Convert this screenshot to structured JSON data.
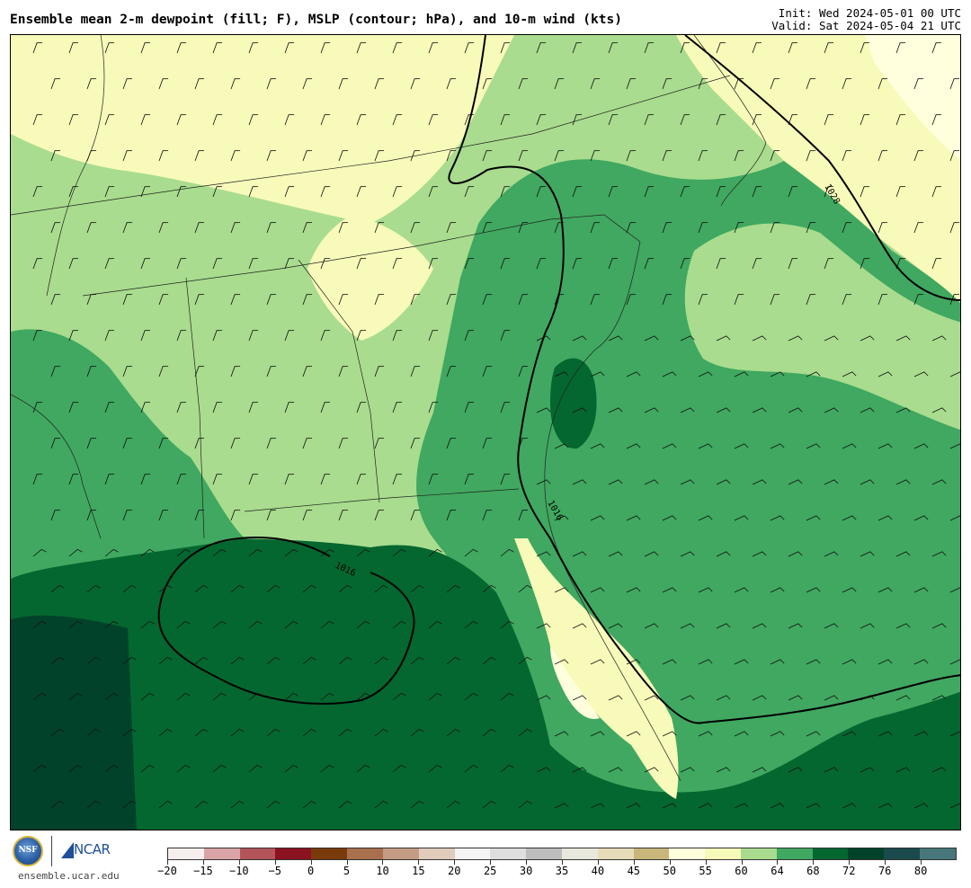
{
  "header": {
    "title": "Ensemble mean 2-m dewpoint (fill; F), MSLP (contour; hPa), and 10-m wind (kts)",
    "init": "Init: Wed 2024-05-01 00 UTC",
    "valid": "Valid: Sat 2024-05-04 21 UTC"
  },
  "map": {
    "contour_labels": [
      "1028",
      "1016",
      "1016"
    ]
  },
  "colorbar": {
    "ticks": [
      "−20",
      "−15",
      "−10",
      "−5",
      "0",
      "5",
      "10",
      "15",
      "20",
      "25",
      "30",
      "35",
      "40",
      "45",
      "50",
      "55",
      "60",
      "64",
      "68",
      "72",
      "76",
      "80"
    ],
    "colors": [
      "#f7eeee",
      "#d9a3a8",
      "#b4535a",
      "#8b1221",
      "#7a3b0b",
      "#a8704d",
      "#c49c83",
      "#e1cbbb",
      "#f4f4f4",
      "#dedede",
      "#bdbdbd",
      "#e8e8dc",
      "#e7dcba",
      "#c9b67b",
      "#ffffdd",
      "#f8fab9",
      "#a9dc8e",
      "#40a860",
      "#04672f",
      "#01432a",
      "#1a4a4b",
      "#47777a"
    ]
  },
  "footer": {
    "logo_nsf": "NSF",
    "logo_ncar": "NCAR",
    "url": "ensemble.ucar.edu"
  }
}
